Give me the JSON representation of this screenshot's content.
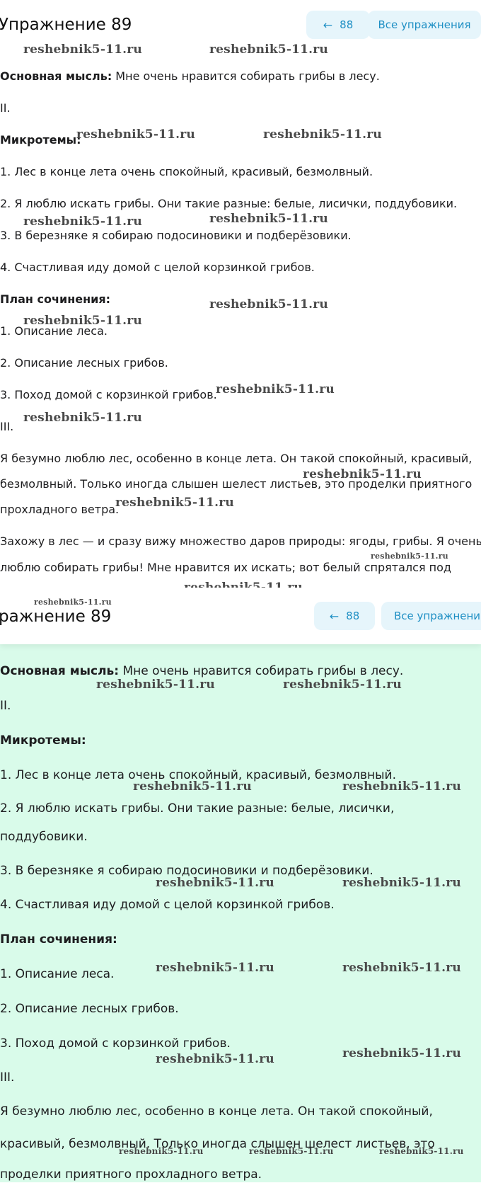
{
  "shot1": {
    "title": "Упражнение 89",
    "prev_button": "88",
    "all_button": "Все упражнения",
    "lines": [
      {
        "strong": "Основная мысль:",
        "text": " Мне очень нравится собирать грибы в лесу."
      },
      {
        "strong": "",
        "text": "II."
      },
      {
        "strong": "Микротемы:",
        "text": ""
      },
      {
        "strong": "",
        "text": "1. Лес в конце лета очень спокойный, красивый, безмолвный."
      },
      {
        "strong": "",
        "text": "2. Я люблю искать грибы. Они такие разные: белые, лисички, поддубовики."
      },
      {
        "strong": "",
        "text": "3. В березняке я собираю подосиновики и подберёзовики."
      },
      {
        "strong": "",
        "text": "4. Счастливая иду домой с целой корзинкой грибов."
      },
      {
        "strong": "План сочинения:",
        "text": ""
      },
      {
        "strong": "",
        "text": "1. Описание леса."
      },
      {
        "strong": "",
        "text": "2. Описание лесных грибов."
      },
      {
        "strong": "",
        "text": "3. Поход домой с корзинкой грибов."
      },
      {
        "strong": "",
        "text": "III."
      },
      {
        "strong": "",
        "text": "Я безумно люблю лес, особенно в конце лета. Он такой спокойный, красивый,"
      },
      {
        "strong": "",
        "text": "безмолвный. Только иногда слышен шелест листьев, это проделки приятного"
      },
      {
        "strong": "",
        "text": "прохладного ветра."
      },
      {
        "strong": "",
        "text": "Захожу в лес — и сразу вижу множество даров природы: ягоды, грибы. Я очень"
      },
      {
        "strong": "",
        "text": "люблю собирать грибы! Мне нравится их искать; вот белый спрятался под"
      }
    ]
  },
  "shot2": {
    "title": "ражнение 89",
    "prev_button": "88",
    "all_button": "Все упражнени",
    "lines": [
      {
        "strong": "Основная мысль:",
        "text": " Мне очень нравится собирать грибы в лесу."
      },
      {
        "strong": "",
        "text": "II."
      },
      {
        "strong": "Микротемы:",
        "text": ""
      },
      {
        "strong": "",
        "text": "1. Лес в конце лета очень спокойный, красивый, безмолвный."
      },
      {
        "strong": "",
        "text": "2. Я люблю искать грибы. Они такие разные: белые, лисички,"
      },
      {
        "strong": "",
        "text": "поддубовики."
      },
      {
        "strong": "",
        "text": "3. В березняке я собираю подосиновики и подберёзовики."
      },
      {
        "strong": "",
        "text": "4. Счастливая иду домой с целой корзинкой грибов."
      },
      {
        "strong": "План сочинения:",
        "text": ""
      },
      {
        "strong": "",
        "text": "1. Описание леса."
      },
      {
        "strong": "",
        "text": "2. Описание лесных грибов."
      },
      {
        "strong": "",
        "text": "3. Поход домой с корзинкой грибов."
      },
      {
        "strong": "",
        "text": "III."
      },
      {
        "strong": "",
        "text": "Я безумно люблю лес, особенно в конце лета. Он такой спокойный,"
      },
      {
        "strong": "",
        "text": "красивый, безмолвный. Только иногда слышен шелест листьев, это"
      },
      {
        "strong": "",
        "text": "проделки приятного прохладного ветра."
      }
    ]
  },
  "watermark": "reshebnik5-11.ru",
  "colors": {
    "accent": "#1e8fc4",
    "button_bg": "#e6f5fb",
    "mint_bg": "#d9fbea"
  },
  "icons": {
    "back": "arrow-left-icon"
  }
}
